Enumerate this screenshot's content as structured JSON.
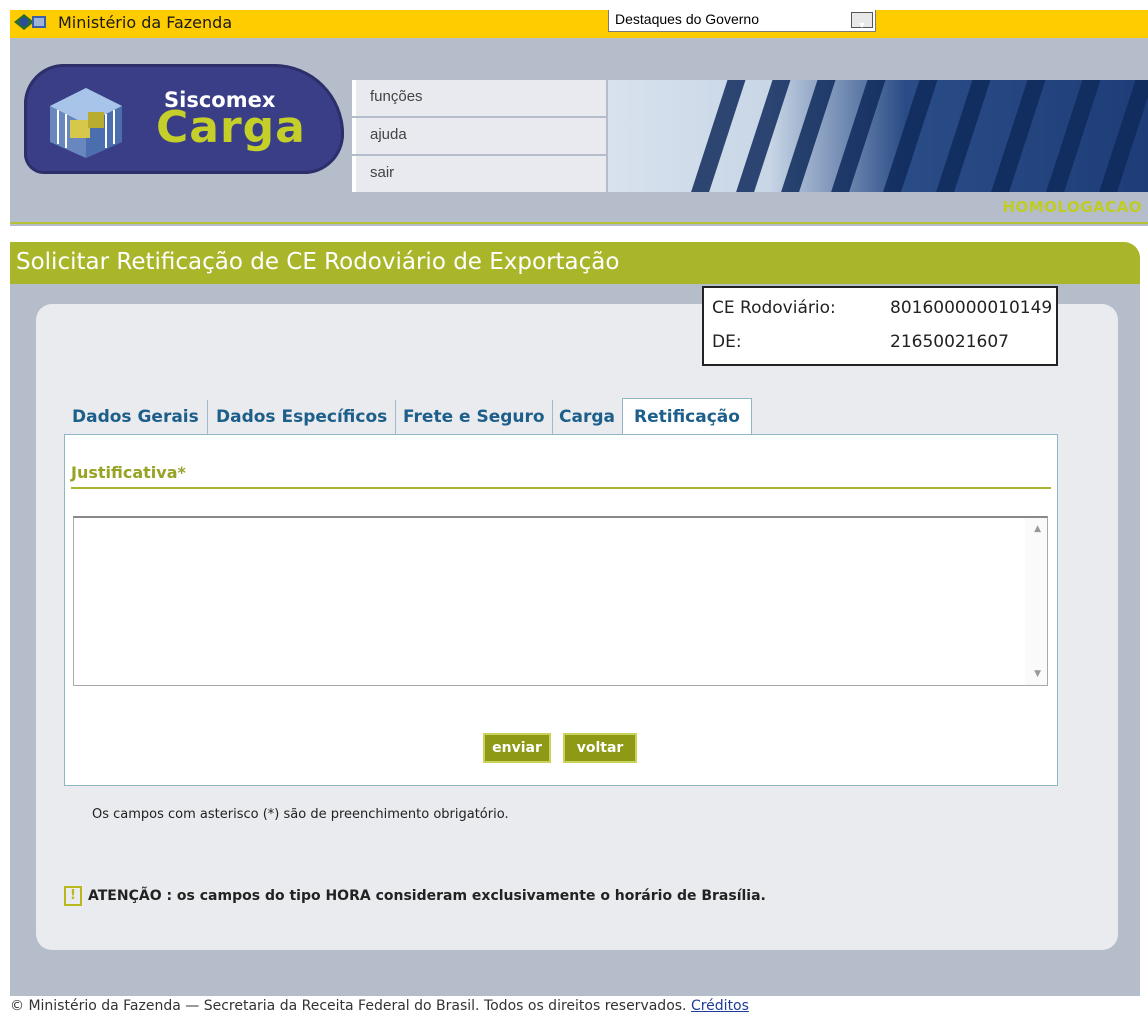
{
  "govbar": {
    "ministry": "Ministério da Fazenda",
    "destaques": "Destaques do Governo"
  },
  "logo": {
    "line1": "Siscomex",
    "line2": "Carga"
  },
  "menu": {
    "items": [
      {
        "label": "funções"
      },
      {
        "label": "ajuda"
      },
      {
        "label": "sair"
      }
    ]
  },
  "environment": "HOMOLOGACAO",
  "page": {
    "title": "Solicitar Retificação de CE Rodoviário de Exportação"
  },
  "ce": {
    "ce_label": "CE Rodoviário:",
    "ce_value": "801600000010149",
    "de_label": "DE:",
    "de_value": "21650021607"
  },
  "tabs": [
    {
      "label": "Dados Gerais"
    },
    {
      "label": "Dados Específicos"
    },
    {
      "label": "Frete e Seguro"
    },
    {
      "label": "Carga"
    },
    {
      "label": "Retificação",
      "active": true
    }
  ],
  "form": {
    "justificativa_label": "Justificativa*",
    "justificativa_value": "",
    "enviar": "enviar",
    "voltar": "voltar"
  },
  "notes": {
    "required": "Os campos com asterisco (*) são de preenchimento obrigatório.",
    "warning_icon": "!",
    "warning": "ATENÇÃO : os campos do tipo HORA consideram exclusivamente o horário de Brasília."
  },
  "footer": {
    "text": "© Ministério da Fazenda — Secretaria da Receita Federal do Brasil. Todos os direitos reservados.",
    "link": "Créditos"
  },
  "colors": {
    "govbar": "#ffcc00",
    "accent": "#aab62a",
    "tab_text": "#1d5f8a",
    "header_bg": "#b4bdc9"
  }
}
